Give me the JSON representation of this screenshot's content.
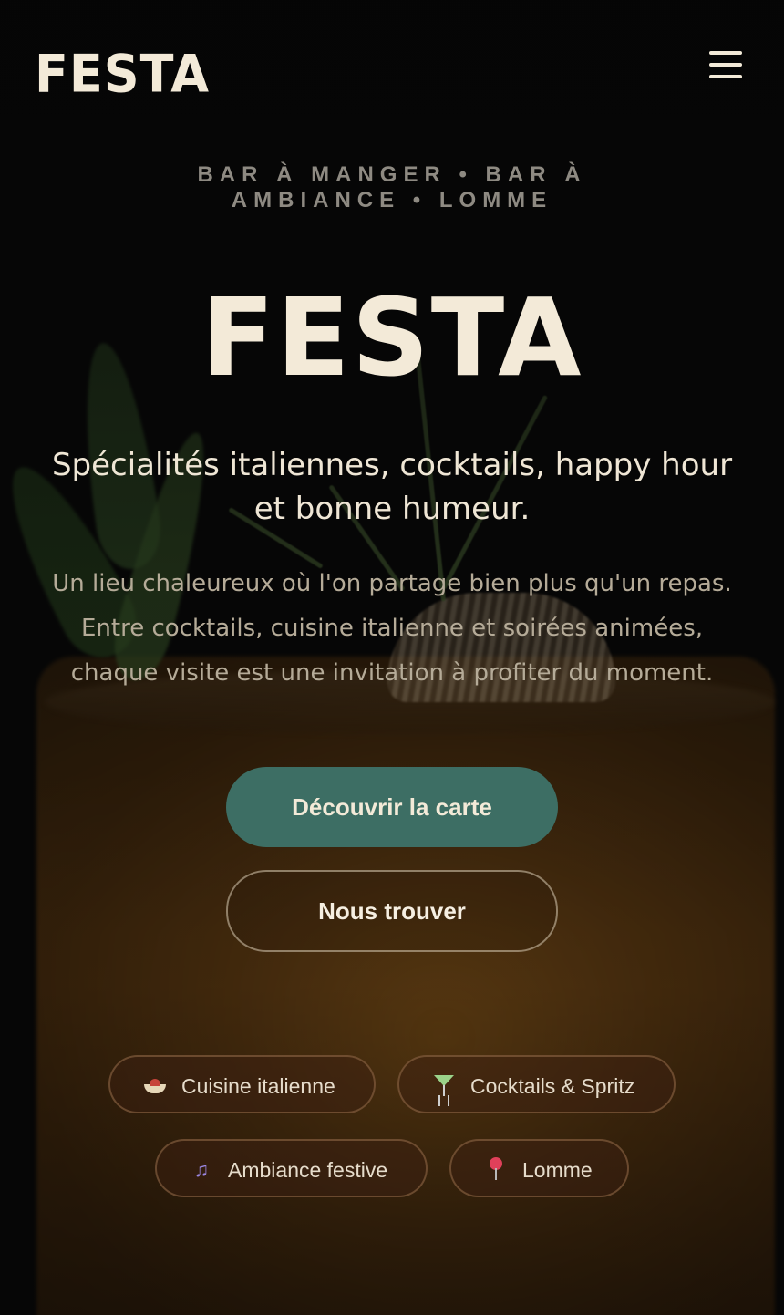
{
  "header": {
    "logo": "FESTA",
    "menu_icon": "hamburger-menu-icon"
  },
  "hero": {
    "tagline": "BAR À MANGER • BAR À AMBIANCE • LOMME",
    "logo": "FESTA",
    "subtitle": "Spécialités italiennes, cocktails, happy hour et bonne humeur.",
    "description": "Un lieu chaleureux où l'on partage bien plus qu'un repas. Entre cocktails, cuisine italienne et soirées animées, chaque visite est une invitation à profiter du moment.",
    "primary_button": "Découvrir la carte",
    "secondary_button": "Nous trouver"
  },
  "features": [
    {
      "icon": "pasta-icon",
      "label": "Cuisine italienne"
    },
    {
      "icon": "cocktail-icon",
      "label": "Cocktails & Spritz"
    },
    {
      "icon": "music-note-icon",
      "label": "Ambiance festive"
    },
    {
      "icon": "map-pin-icon",
      "label": "Lomme"
    }
  ],
  "colors": {
    "background": "#070707",
    "cream": "#f3ead8",
    "primary_button": "#3d6e64",
    "tagline": "#8e8a82",
    "description": "#b5ab98"
  }
}
